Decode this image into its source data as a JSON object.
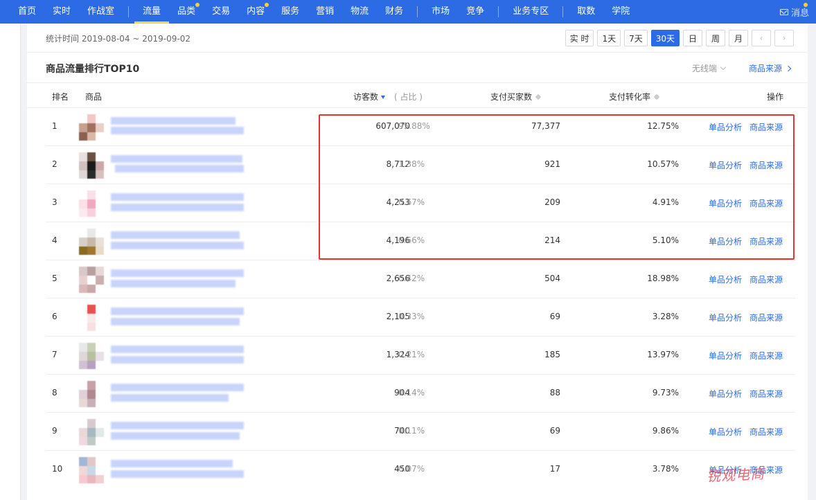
{
  "nav": {
    "items": [
      {
        "label": "首页",
        "active": false,
        "dot": false
      },
      {
        "label": "实时",
        "active": false,
        "dot": false
      },
      {
        "label": "作战室",
        "active": false,
        "dot": false
      },
      {
        "label": "流量",
        "active": true,
        "dot": false
      },
      {
        "label": "品类",
        "active": false,
        "dot": true
      },
      {
        "label": "交易",
        "active": false,
        "dot": false
      },
      {
        "label": "内容",
        "active": false,
        "dot": true
      },
      {
        "label": "服务",
        "active": false,
        "dot": false
      },
      {
        "label": "营销",
        "active": false,
        "dot": false
      },
      {
        "label": "物流",
        "active": false,
        "dot": false
      },
      {
        "label": "财务",
        "active": false,
        "dot": false
      },
      {
        "label": "市场",
        "active": false,
        "dot": false
      },
      {
        "label": "竞争",
        "active": false,
        "dot": false
      },
      {
        "label": "业务专区",
        "active": false,
        "dot": false
      },
      {
        "label": "取数",
        "active": false,
        "dot": false
      },
      {
        "label": "学院",
        "active": false,
        "dot": false
      }
    ],
    "message_label": "消息",
    "message_icon": "mail-icon"
  },
  "stat": {
    "range_text": "统计时间 2019-08-04 ~ 2019-09-02",
    "buttons": [
      "实 时",
      "1天",
      "7天",
      "30天",
      "日",
      "周",
      "月"
    ],
    "active_button": "30天",
    "prev_icon": "chevron-left-icon",
    "next_icon": "chevron-right-icon"
  },
  "section": {
    "title": "商品流量排行TOP10",
    "device": "无线端",
    "source_link": "商品来源"
  },
  "table": {
    "headers": {
      "rank": "排名",
      "product": "商品",
      "visitors": "访客数",
      "share": "( 占比 )",
      "buyers": "支付买家数",
      "conversion": "支付转化率",
      "action": "操作"
    },
    "rows": [
      {
        "rank": "1",
        "visitors": "607,070",
        "share": "95.88%",
        "buyers": "77,377",
        "rate": "12.75%",
        "a1": "单品分析",
        "a2": "商品来源"
      },
      {
        "rank": "2",
        "visitors": "8,712",
        "share": "1.38%",
        "buyers": "921",
        "rate": "10.57%",
        "a1": "单品分析",
        "a2": "商品来源"
      },
      {
        "rank": "3",
        "visitors": "4,253",
        "share": "0.67%",
        "buyers": "209",
        "rate": "4.91%",
        "a1": "单品分析",
        "a2": "商品来源"
      },
      {
        "rank": "4",
        "visitors": "4,196",
        "share": "0.66%",
        "buyers": "214",
        "rate": "5.10%",
        "a1": "单品分析",
        "a2": "商品来源"
      },
      {
        "rank": "5",
        "visitors": "2,656",
        "share": "0.42%",
        "buyers": "504",
        "rate": "18.98%",
        "a1": "单品分析",
        "a2": "商品来源"
      },
      {
        "rank": "6",
        "visitors": "2,105",
        "share": "0.33%",
        "buyers": "69",
        "rate": "3.28%",
        "a1": "单品分析",
        "a2": "商品来源"
      },
      {
        "rank": "7",
        "visitors": "1,324",
        "share": "0.21%",
        "buyers": "185",
        "rate": "13.97%",
        "a1": "单品分析",
        "a2": "商品来源"
      },
      {
        "rank": "8",
        "visitors": "904",
        "share": "0.14%",
        "buyers": "88",
        "rate": "9.73%",
        "a1": "单品分析",
        "a2": "商品来源"
      },
      {
        "rank": "9",
        "visitors": "700",
        "share": "0.11%",
        "buyers": "69",
        "rate": "9.86%",
        "a1": "单品分析",
        "a2": "商品来源"
      },
      {
        "rank": "10",
        "visitors": "450",
        "share": "0.07%",
        "buyers": "17",
        "rate": "3.78%",
        "a1": "单品分析",
        "a2": "商品来源"
      }
    ]
  },
  "colors": {
    "accent": "#2d6be4",
    "highlight_border": "#e8322f",
    "nav_dot": "#ffcf3a"
  },
  "watermark": "锐观电商"
}
